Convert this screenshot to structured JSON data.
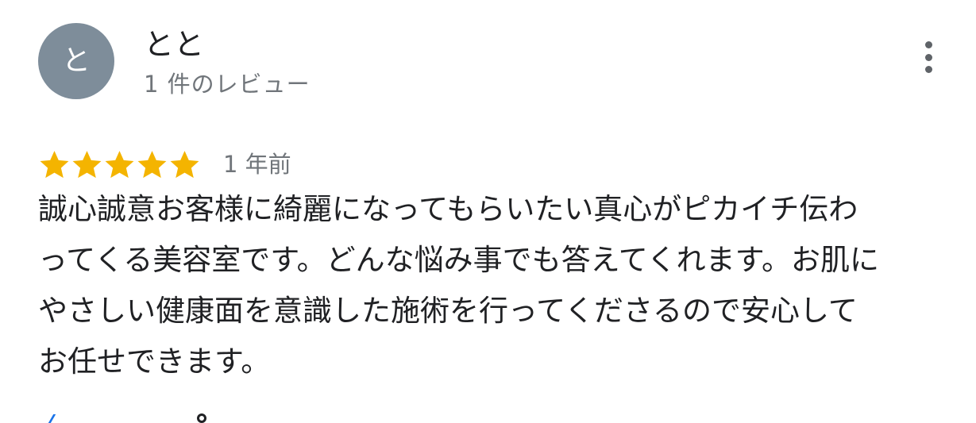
{
  "reviewer": {
    "avatar_initial": "と",
    "avatar_color": "#7e8d9a",
    "name": "とと",
    "review_count": "1 件のレビュー"
  },
  "menu": {
    "icon": "more-vert-icon"
  },
  "review": {
    "rating": 5,
    "max_rating": 5,
    "star_color": "#f4b400",
    "date": "1 年前",
    "text": "誠心誠意お客様に綺麗になってもらいたい真心がピカイチ伝わってくる美容室です。どんな悩み事でも答えてくれます。お肌にやさしい健康面を意識した施術を行ってくださるので安心してお任せできます。"
  }
}
